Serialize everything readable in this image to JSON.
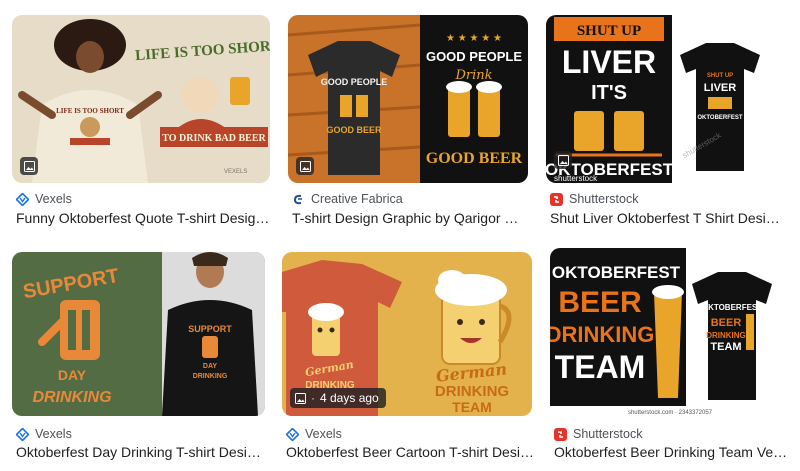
{
  "results": [
    {
      "source": "Vexels",
      "title": "Funny Oktoberfest Quote T-shirt Desig…",
      "image_text": [
        "LIFE IS TOO SHORT",
        "TO DRINK BAD BEER",
        "VEXELS"
      ]
    },
    {
      "source": "Creative Fabrica",
      "title": "T-shirt Design Graphic by Qarigor …",
      "image_text": [
        "GOOD PEOPLE",
        "Drink",
        "GOOD BEER"
      ]
    },
    {
      "source": "Shutterstock",
      "title": "Shut Liver Oktoberfest T Shirt Desi…",
      "image_text": [
        "SHUT UP",
        "LIVER",
        "IT'S",
        "OKTOBERFEST",
        "shutterstock"
      ]
    },
    {
      "source": "Vexels",
      "title": "Oktoberfest Day Drinking T-shirt Desi…",
      "image_text": [
        "SUPPORT",
        "DAY",
        "DRINKING"
      ]
    },
    {
      "source": "Vexels",
      "title": "Oktoberfest Beer Cartoon T-shirt Desig…",
      "image_text": [
        "German",
        "DRINKING",
        "TEAM"
      ],
      "badge": "4 days ago"
    },
    {
      "source": "Shutterstock",
      "title": "Oktoberfest Beer Drinking Team Ve…",
      "image_text": [
        "OKTOBERFEST",
        "BEER",
        "DRINKING",
        "TEAM",
        "shutterstock.com · 2343372057"
      ]
    }
  ],
  "colors": {
    "vexels_icon": "#1a73e8",
    "shutterstock_icon": "#e8332a",
    "cf_icon": "#1f4e99"
  }
}
